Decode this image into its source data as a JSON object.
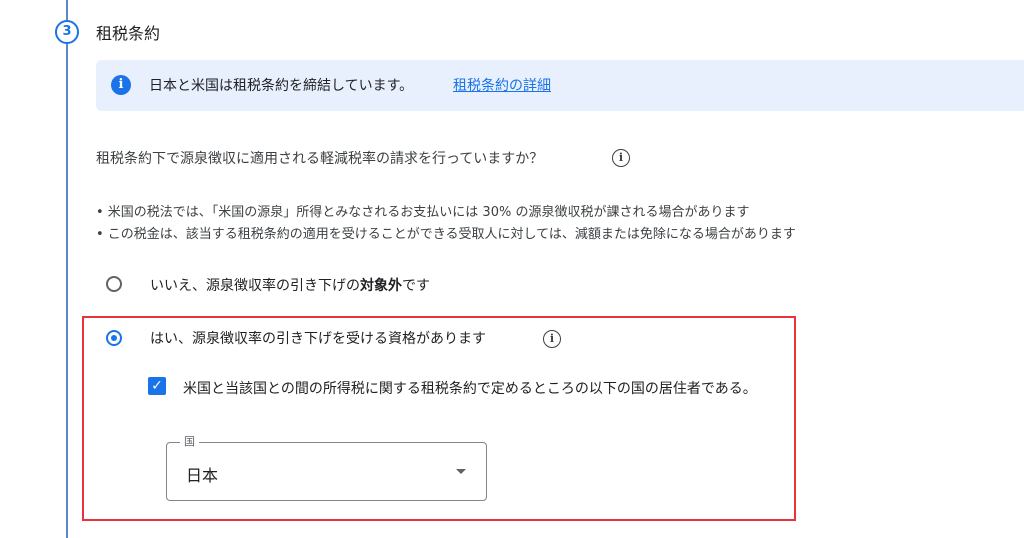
{
  "step": {
    "number": "3",
    "title": "租税条約"
  },
  "info_banner": {
    "icon": "info-icon",
    "text": "日本と米国は租税条約を締結しています。",
    "link": "租税条約の詳細"
  },
  "question": {
    "text": "租税条約下で源泉徴収に適用される軽減税率の請求を行っていますか？",
    "icon": "help-icon"
  },
  "bullets": [
    "• 米国の税法では、「米国の源泉」所得とみなされるお支払いには 30% の源泉徴収税が課される場合があります",
    "• この税金は、該当する租税条約の適用を受けることができる受取人に対しては、減額または免除になる場合があります"
  ],
  "options": {
    "no": {
      "text_prefix": "いいえ、源泉徴収率の引き下げの",
      "text_bold": "対象外",
      "text_suffix": "です",
      "selected": false
    },
    "yes": {
      "text": "はい、源泉徴収率の引き下げを受ける資格があります",
      "selected": true
    }
  },
  "residency_checkbox": {
    "text": "米国と当該国との間の所得税に関する租税条約で定めるところの以下の国の居住者である。",
    "checked": true
  },
  "country_select": {
    "label": "国",
    "value": "日本"
  },
  "colors": {
    "accent": "#1a73e8",
    "highlight": "#e8323c",
    "banner_bg": "#e8f0fe"
  }
}
